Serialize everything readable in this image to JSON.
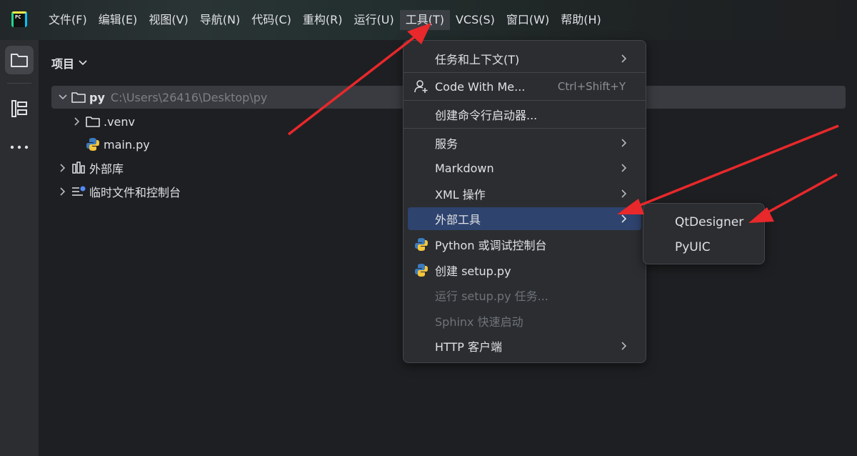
{
  "menubar": {
    "logo_text": "PC",
    "items": [
      "文件(F)",
      "编辑(E)",
      "视图(V)",
      "导航(N)",
      "代码(C)",
      "重构(R)",
      "运行(U)",
      "工具(T)",
      "VCS(S)",
      "窗口(W)",
      "帮助(H)"
    ],
    "active_index": 7
  },
  "panel": {
    "title": "项目",
    "tree": {
      "root_name": "py",
      "root_path": "C:\\Users\\26416\\Desktop\\py",
      "venv": ".venv",
      "main_file": "main.py",
      "external_libs": "外部库",
      "scratches": "临时文件和控制台"
    }
  },
  "tools_menu": {
    "items": [
      {
        "label": "任务和上下文(T)",
        "submenu": true
      },
      {
        "label": "Code With Me...",
        "shortcut": "Ctrl+Shift+Y"
      },
      {
        "label": "创建命令行启动器..."
      },
      {
        "label": "服务",
        "submenu": true
      },
      {
        "label": "Markdown",
        "submenu": true
      },
      {
        "label": "XML 操作",
        "submenu": true
      },
      {
        "label": "外部工具",
        "submenu": true,
        "highlighted": true
      },
      {
        "label": "Python 或调试控制台"
      },
      {
        "label": "创建 setup.py"
      },
      {
        "label": "运行 setup.py 任务...",
        "disabled": true
      },
      {
        "label": "Sphinx 快速启动",
        "disabled": true
      },
      {
        "label": "HTTP 客户端",
        "submenu": true
      }
    ]
  },
  "external_tools_submenu": {
    "items": [
      "QtDesigner",
      "PyUIC"
    ]
  },
  "colors": {
    "menu_highlight": "#2e436e",
    "annotation_arrow": "#e8282b",
    "background": "#1e1f22"
  }
}
